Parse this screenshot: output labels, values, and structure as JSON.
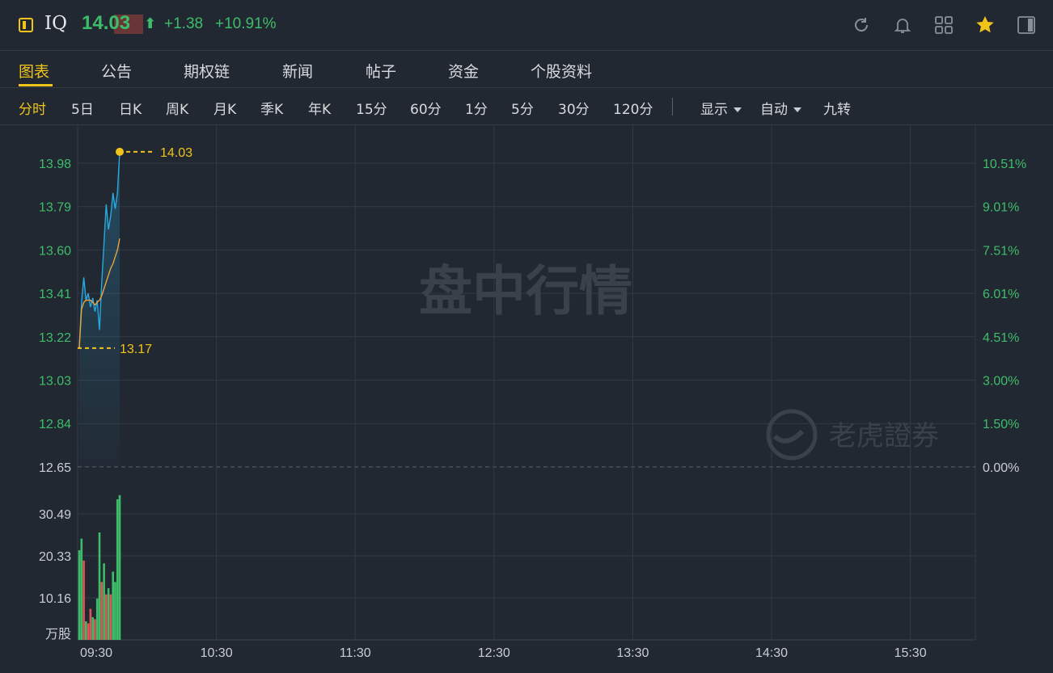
{
  "header": {
    "symbol": "IQ",
    "price": "14.03",
    "arrow": "⬆",
    "change": "+1.38",
    "change_pct": "+10.91%",
    "icons": [
      "refresh-icon",
      "bell-icon",
      "grid-icon",
      "star-icon",
      "sidebar-toggle-icon"
    ]
  },
  "tabs": [
    "图表",
    "公告",
    "期权链",
    "新闻",
    "帖子",
    "资金",
    "个股资料"
  ],
  "active_tab": "图表",
  "periods": [
    "分时",
    "5日",
    "日K",
    "周K",
    "月K",
    "季K",
    "年K",
    "15分",
    "60分",
    "1分",
    "5分",
    "30分",
    "120分"
  ],
  "active_period": "分时",
  "options": {
    "display": "显示",
    "auto": "自动",
    "nine": "九转"
  },
  "watermark": {
    "main": "盘中行情",
    "brand": "老虎證券"
  },
  "colors": {
    "up": "#3dbd6a",
    "down": "#e05555",
    "price_line": "#29a8e0",
    "avg_line": "#e8a23d",
    "accent": "#f0c419"
  },
  "chart_data": {
    "type": "line",
    "price_ticks": [
      "13.98",
      "13.79",
      "13.60",
      "13.41",
      "13.22",
      "13.03",
      "12.84",
      "12.65"
    ],
    "price_tick_values": [
      13.98,
      13.79,
      13.6,
      13.41,
      13.22,
      13.03,
      12.84,
      12.65
    ],
    "pct_ticks": [
      "10.51%",
      "9.01%",
      "7.51%",
      "6.01%",
      "4.51%",
      "3.00%",
      "1.50%",
      "0.00%"
    ],
    "volume_ticks": [
      "30.49",
      "20.33",
      "10.16"
    ],
    "volume_tick_values": [
      30.49,
      20.33,
      10.16
    ],
    "volume_unit": "万股",
    "time_ticks": [
      "09:30",
      "10:30",
      "11:30",
      "12:30",
      "13:30",
      "14:30",
      "15:30"
    ],
    "prev_close": 12.65,
    "high_label": "14.03",
    "high": 14.03,
    "low_label": "13.17",
    "low": 13.17,
    "ylim": [
      12.65,
      14.03
    ],
    "series": [
      {
        "values": [
          13.17,
          13.37,
          13.48,
          13.38,
          13.41,
          13.35,
          13.39,
          13.33,
          13.38,
          13.25,
          13.46,
          13.63,
          13.8,
          13.69,
          13.75,
          13.85,
          13.78,
          13.85,
          14.03
        ]
      },
      {
        "values": [
          13.17,
          13.34,
          13.37,
          13.38,
          13.38,
          13.38,
          13.37,
          13.36,
          13.37,
          13.38,
          13.4,
          13.43,
          13.46,
          13.49,
          13.52,
          13.54,
          13.57,
          13.6,
          13.65
        ]
      }
    ],
    "volume": [
      21.7,
      24.5,
      19.2,
      4.5,
      4.0,
      7.5,
      5.5,
      5.0,
      10.0,
      26.0,
      14.0,
      18.5,
      11.0,
      12.5,
      11.0,
      16.5,
      14.0,
      34.0,
      35.0
    ],
    "volume_up": [
      true,
      true,
      false,
      true,
      false,
      false,
      true,
      false,
      true,
      true,
      false,
      true,
      false,
      true,
      false,
      true,
      true,
      true,
      true
    ]
  }
}
